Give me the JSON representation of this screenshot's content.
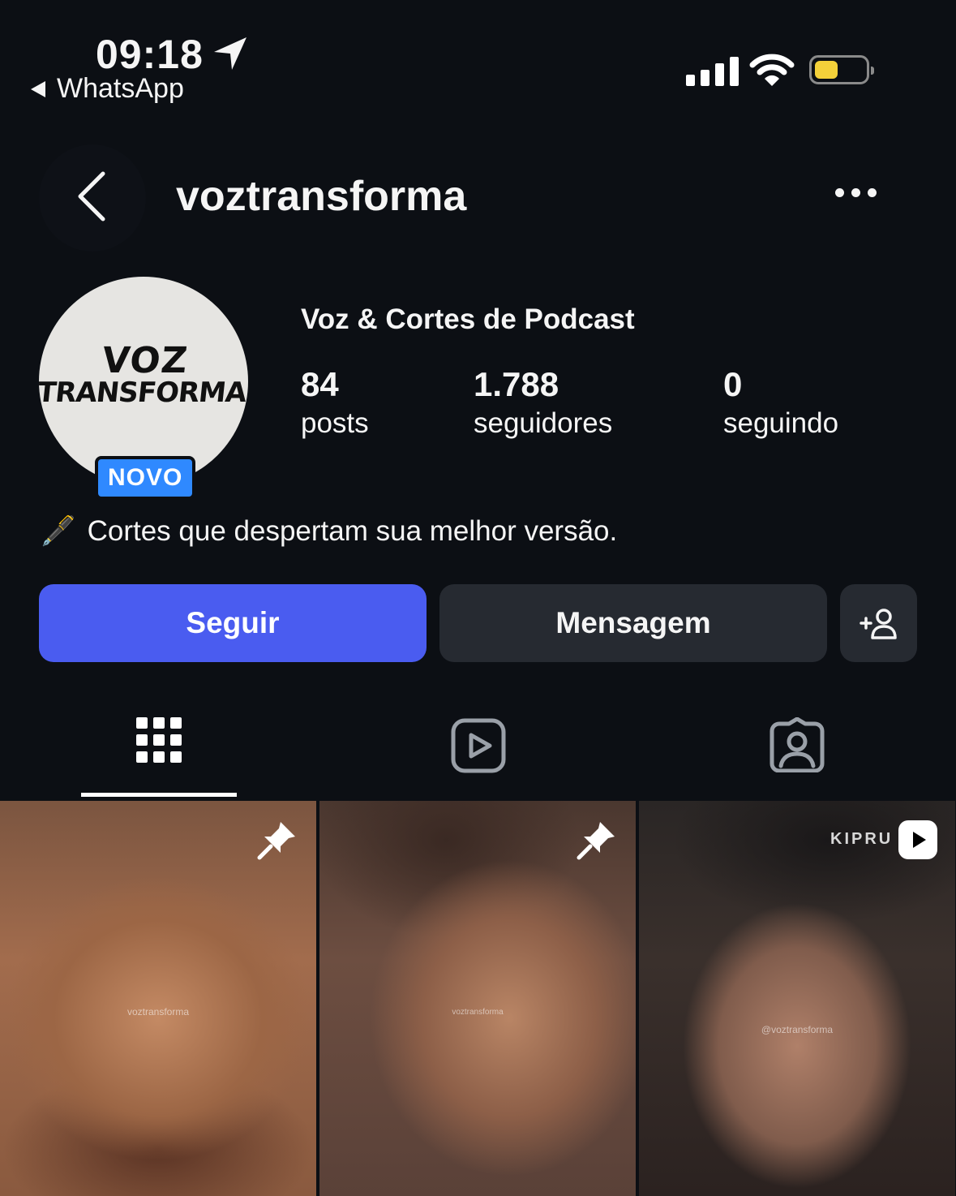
{
  "status_bar": {
    "time": "09:18",
    "back_app": "WhatsApp",
    "battery_color": "#f4d13a"
  },
  "header": {
    "username": "voztransforma"
  },
  "profile": {
    "avatar_text_line1": "VOZ",
    "avatar_text_line2": "TRANSFORMA",
    "badge": "NOVO",
    "display_name": "Voz & Cortes de Podcast",
    "stats": {
      "posts": {
        "value": "84",
        "label": "posts"
      },
      "followers": {
        "value": "1.788",
        "label": "seguidores"
      },
      "following": {
        "value": "0",
        "label": "seguindo"
      }
    },
    "bio_emoji": "🖋️",
    "bio": "Cortes que despertam sua melhor versão."
  },
  "actions": {
    "follow_label": "Seguir",
    "message_label": "Mensagem",
    "follow_color": "#4a5cf0"
  },
  "tabs": [
    {
      "icon": "grid-icon",
      "active": true
    },
    {
      "icon": "reels-icon",
      "active": false
    },
    {
      "icon": "tagged-icon",
      "active": false
    }
  ],
  "posts": [
    {
      "watermark": "voztransforma",
      "pinned": true
    },
    {
      "watermark": "voztransforma",
      "pinned": true
    },
    {
      "watermark": "@voztransforma",
      "pinned": false,
      "reel": true,
      "overlay_text": "KIPRU"
    }
  ]
}
